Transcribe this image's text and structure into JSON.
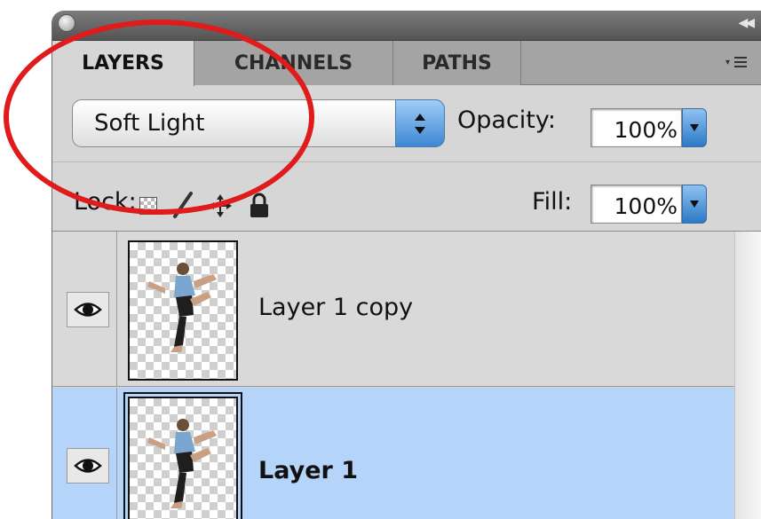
{
  "tabs": [
    {
      "label": "LAYERS",
      "active": true
    },
    {
      "label": "CHANNELS",
      "active": false
    },
    {
      "label": "PATHS",
      "active": false
    }
  ],
  "blend_mode": {
    "value": "Soft Light"
  },
  "opacity": {
    "label": "Opacity:",
    "value": "100%"
  },
  "lock": {
    "label": "Lock:",
    "icons": [
      "lock-transparent-pixels-icon",
      "lock-image-pixels-icon",
      "lock-position-icon",
      "lock-all-icon"
    ]
  },
  "fill": {
    "label": "Fill:",
    "value": "100%"
  },
  "layers": [
    {
      "name": "Layer 1 copy",
      "visible": true,
      "selected": false
    },
    {
      "name": "Layer 1",
      "visible": true,
      "selected": true
    }
  ],
  "colors": {
    "selection": "#b5d4f9",
    "annotation": "#e01b1b",
    "panel": "#d6d6d6"
  }
}
